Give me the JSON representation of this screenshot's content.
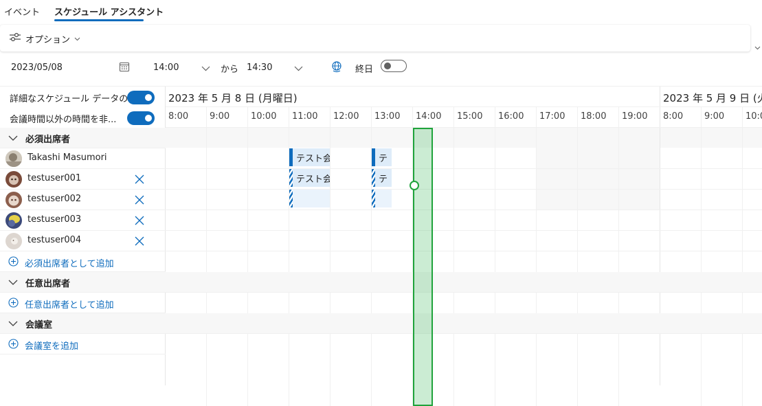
{
  "tabs": [
    {
      "label": "イベント"
    },
    {
      "label": "スケジュール アシスタント"
    }
  ],
  "options": {
    "label": "オプション"
  },
  "time_row": {
    "date": "2023/05/08",
    "start_time": "14:00",
    "from_label": "から",
    "end_time": "14:30",
    "all_day_label": "終日",
    "all_day": false
  },
  "settings": [
    {
      "label": "詳細なスケジュール データの...",
      "on": true
    },
    {
      "label": "会議時間以外の時間を非...",
      "on": true
    }
  ],
  "timeline": {
    "days": [
      {
        "label": "2023 年 5 月 8 日 (月曜日)"
      },
      {
        "label": "2023 年 5 月 9 日 (火"
      }
    ],
    "hours_day1": [
      "8:00",
      "9:00",
      "10:00",
      "11:00",
      "12:00",
      "13:00",
      "14:00",
      "15:00",
      "16:00",
      "17:00",
      "18:00",
      "19:00"
    ],
    "hours_day2": [
      "8:00",
      "9:00",
      "10:00"
    ]
  },
  "sections": {
    "required": {
      "title": "必須出席者",
      "attendees": [
        {
          "name": "Takashi Masumori",
          "removable": false
        },
        {
          "name": "testuser001",
          "removable": true
        },
        {
          "name": "testuser002",
          "removable": true
        },
        {
          "name": "testuser003",
          "removable": true
        },
        {
          "name": "testuser004",
          "removable": true
        }
      ],
      "add_label": "必須出席者として追加"
    },
    "optional": {
      "title": "任意出席者",
      "add_label": "任意出席者として追加"
    },
    "rooms": {
      "title": "会議室",
      "add_label": "会議室を追加"
    }
  },
  "busy_blocks": {
    "b1": "テスト会",
    "b2": "テ",
    "b3": "テスト会",
    "b4": "テ"
  },
  "colors": {
    "accent": "#0f6cbd",
    "slot_border": "#1fa33b",
    "busy_fill": "#deecf9"
  }
}
